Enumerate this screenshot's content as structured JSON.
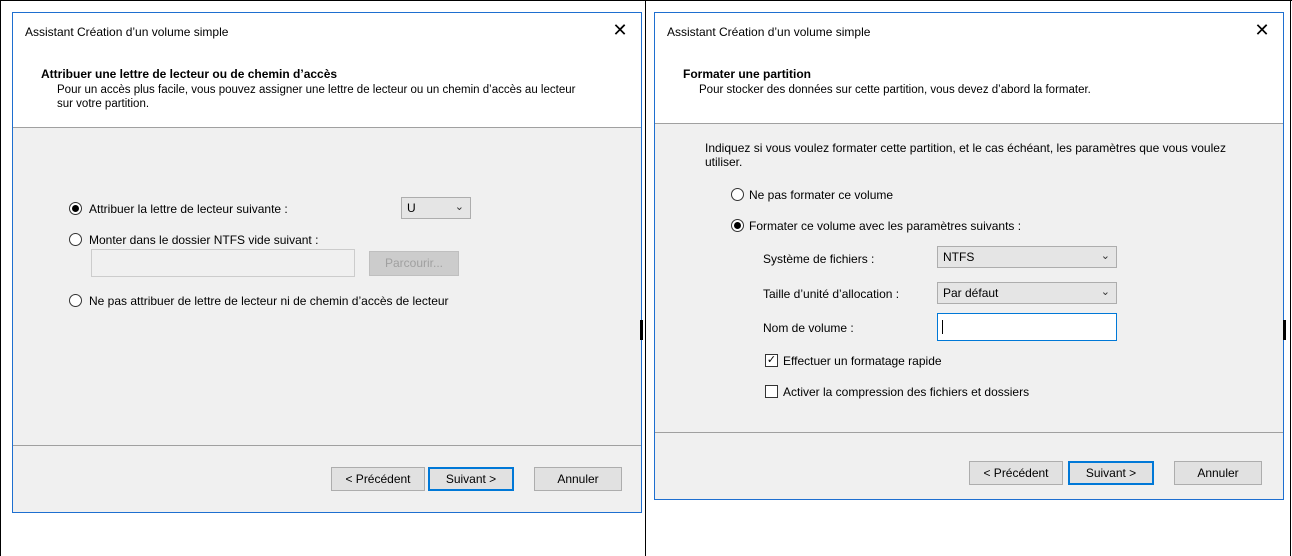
{
  "left": {
    "title": "Assistant Création d’un volume simple",
    "close": "✕",
    "header_title": "Attribuer une lettre de lecteur ou de chemin d’accès",
    "header_desc": "Pour un accès plus facile, vous pouvez assigner une lettre de lecteur ou un chemin d’accès au lecteur sur votre partition.",
    "opt_assign": "Attribuer la lettre de lecteur suivante :",
    "drive_letter": "U",
    "opt_mount": "Monter dans le dossier NTFS vide suivant :",
    "browse": "Parcourir...",
    "opt_none": "Ne pas attribuer de lettre de lecteur ni de chemin d’accès de lecteur",
    "back": "< Précédent",
    "next": "Suivant >",
    "cancel": "Annuler"
  },
  "right": {
    "title": "Assistant Création d’un volume simple",
    "close": "✕",
    "header_title": "Formater une partition",
    "header_desc": "Pour stocker des données sur cette partition, vous devez d’abord la formater.",
    "intro": "Indiquez si vous voulez formater cette partition, et le cas échéant, les paramètres que vous voulez utiliser.",
    "opt_noformat": "Ne pas formater ce volume",
    "opt_format": "Formater ce volume avec les paramètres suivants :",
    "fs_label": "Système de fichiers :",
    "fs_value": "NTFS",
    "alloc_label": "Taille d’unité d’allocation :",
    "alloc_value": "Par défaut",
    "volname_label": "Nom de volume :",
    "volname_value": "",
    "quick_format": "Effectuer un formatage rapide",
    "compression": "Activer la compression des fichiers et dossiers",
    "back": "< Précédent",
    "next": "Suivant >",
    "cancel": "Annuler"
  }
}
